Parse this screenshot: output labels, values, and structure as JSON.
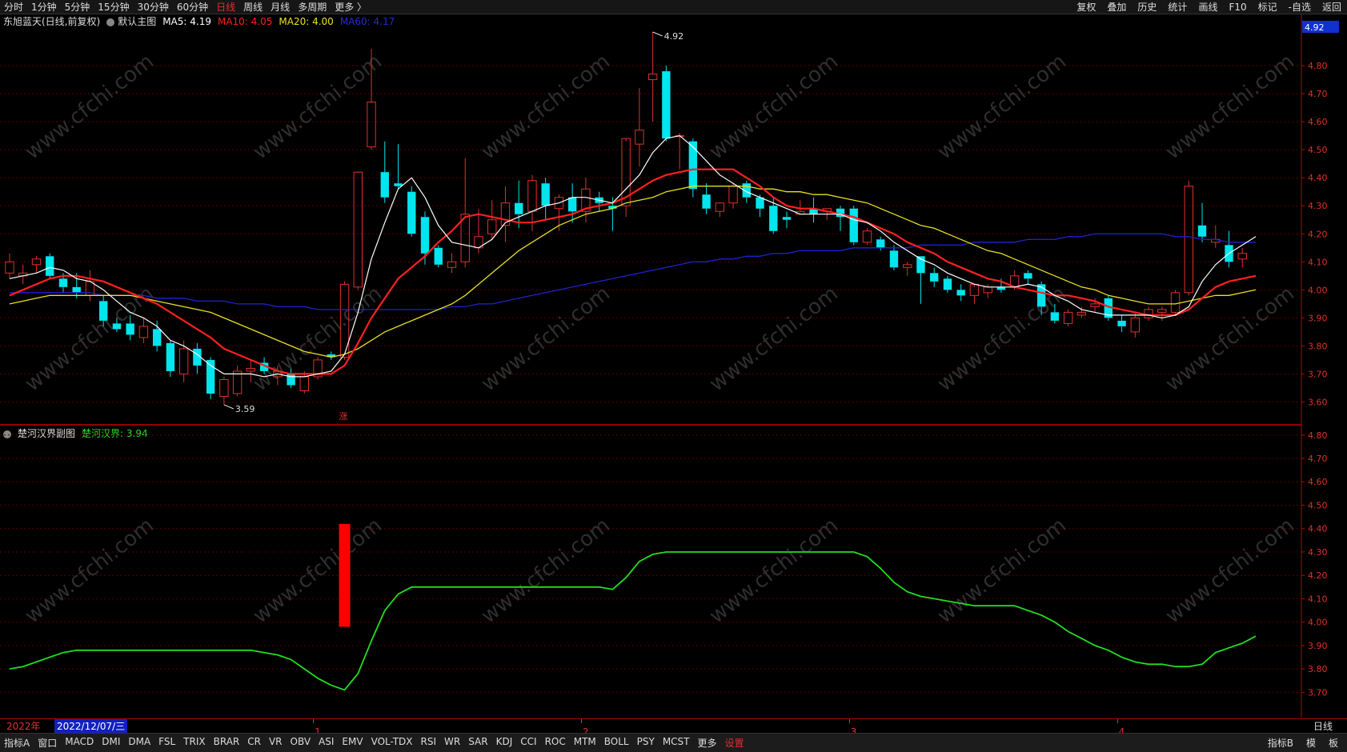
{
  "toolbar": {
    "left": [
      "分时",
      "1分钟",
      "5分钟",
      "15分钟",
      "30分钟",
      "60分钟",
      "日线",
      "周线",
      "月线",
      "多周期",
      "更多 〉"
    ],
    "active": "日线",
    "right": [
      "复权",
      "叠加",
      "历史",
      "统计",
      "画线",
      "F10",
      "标记",
      "-自选",
      "返回"
    ]
  },
  "main_legend": {
    "title": "东旭蓝天(日线,前复权)",
    "chart_name": "默认主图",
    "ma5": "MA5: 4.19",
    "ma10": "MA10: 4.05",
    "ma20": "MA20: 4.00",
    "ma60": "MA60: 4.17"
  },
  "sub_legend": {
    "title": "楚河汉界副图",
    "value": "楚河汉界: 3.94"
  },
  "colors": {
    "up": "#e03030",
    "down": "#00e5ee",
    "ma5": "#ffffff",
    "ma10": "#ff2020",
    "ma20": "#e8e020",
    "ma60": "#2020d0",
    "green": "#22dd22",
    "grid": "#5a0000"
  },
  "current_price_tag": "4.92",
  "rise_marker": "涨",
  "watermark": "www.cfchi.com",
  "timebar": {
    "year": "2022年",
    "cursor_date": "2022/12/07/三",
    "months": [
      "1",
      "2",
      "3",
      "4"
    ],
    "period": "日线"
  },
  "bottom_tabs": [
    "指标A",
    "窗口",
    "MACD",
    "DMI",
    "DMA",
    "FSL",
    "TRIX",
    "BRAR",
    "CR",
    "VR",
    "OBV",
    "ASI",
    "EMV",
    "VOL-TDX",
    "RSI",
    "WR",
    "SAR",
    "KDJ",
    "CCI",
    "ROC",
    "MTM",
    "BOLL",
    "PSY",
    "MCST",
    "更多",
    "设置"
  ],
  "bottom_right": [
    "指标B",
    "模",
    "板"
  ],
  "chart_data": [
    {
      "type": "candlestick",
      "title": "东旭蓝天(日线,前复权)",
      "ylim": [
        3.55,
        4.92
      ],
      "y_ticks": [
        4.8,
        4.7,
        4.6,
        4.5,
        4.4,
        4.3,
        4.2,
        4.1,
        4.0,
        3.9,
        3.8,
        3.7,
        3.6
      ],
      "annotations": [
        {
          "label": "4.92",
          "type": "high"
        },
        {
          "label": "3.59",
          "type": "low"
        }
      ],
      "ohlc": [
        [
          4.06,
          4.13,
          4.04,
          4.1
        ],
        [
          4.05,
          4.09,
          4.02,
          4.06
        ],
        [
          4.09,
          4.12,
          4.06,
          4.11
        ],
        [
          4.12,
          4.13,
          4.04,
          4.05
        ],
        [
          4.04,
          4.06,
          3.99,
          4.01
        ],
        [
          4.01,
          4.06,
          3.97,
          3.99
        ],
        [
          3.98,
          4.07,
          3.96,
          4.03
        ],
        [
          3.96,
          3.98,
          3.87,
          3.89
        ],
        [
          3.88,
          3.9,
          3.85,
          3.86
        ],
        [
          3.88,
          3.91,
          3.82,
          3.84
        ],
        [
          3.83,
          3.9,
          3.81,
          3.87
        ],
        [
          3.86,
          3.89,
          3.78,
          3.8
        ],
        [
          3.81,
          3.82,
          3.69,
          3.71
        ],
        [
          3.7,
          3.82,
          3.67,
          3.79
        ],
        [
          3.79,
          3.81,
          3.7,
          3.73
        ],
        [
          3.75,
          3.76,
          3.61,
          3.63
        ],
        [
          3.62,
          3.69,
          3.59,
          3.68
        ],
        [
          3.63,
          3.73,
          3.62,
          3.71
        ],
        [
          3.71,
          3.75,
          3.67,
          3.72
        ],
        [
          3.74,
          3.76,
          3.7,
          3.71
        ],
        [
          3.69,
          3.73,
          3.66,
          3.71
        ],
        [
          3.7,
          3.72,
          3.65,
          3.66
        ],
        [
          3.64,
          3.71,
          3.63,
          3.69
        ],
        [
          3.69,
          3.76,
          3.68,
          3.75
        ],
        [
          3.77,
          3.78,
          3.75,
          3.76
        ],
        [
          3.76,
          4.03,
          3.75,
          4.02
        ],
        [
          4.01,
          4.42,
          4.0,
          4.42
        ],
        [
          4.51,
          4.86,
          4.5,
          4.67
        ],
        [
          4.42,
          4.53,
          4.31,
          4.33
        ],
        [
          4.38,
          4.52,
          4.36,
          4.37
        ],
        [
          4.35,
          4.37,
          4.19,
          4.2
        ],
        [
          4.26,
          4.28,
          4.09,
          4.13
        ],
        [
          4.15,
          4.16,
          4.08,
          4.09
        ],
        [
          4.08,
          4.13,
          4.06,
          4.1
        ],
        [
          4.1,
          4.47,
          4.08,
          4.27
        ],
        [
          4.15,
          4.29,
          4.13,
          4.19
        ],
        [
          4.2,
          4.32,
          4.18,
          4.25
        ],
        [
          4.23,
          4.37,
          4.17,
          4.31
        ],
        [
          4.31,
          4.39,
          4.22,
          4.27
        ],
        [
          4.28,
          4.41,
          4.21,
          4.39
        ],
        [
          4.38,
          4.4,
          4.25,
          4.3
        ],
        [
          4.29,
          4.34,
          4.21,
          4.33
        ],
        [
          4.33,
          4.38,
          4.24,
          4.28
        ],
        [
          4.28,
          4.4,
          4.24,
          4.36
        ],
        [
          4.33,
          4.35,
          4.28,
          4.31
        ],
        [
          4.3,
          4.33,
          4.21,
          4.29
        ],
        [
          4.3,
          4.53,
          4.26,
          4.54
        ],
        [
          4.52,
          4.72,
          4.44,
          4.57
        ],
        [
          4.75,
          4.92,
          4.6,
          4.77
        ],
        [
          4.78,
          4.8,
          4.53,
          4.54
        ],
        [
          4.55,
          4.56,
          4.43,
          4.55
        ],
        [
          4.53,
          4.54,
          4.33,
          4.36
        ],
        [
          4.34,
          4.38,
          4.27,
          4.29
        ],
        [
          4.28,
          4.31,
          4.26,
          4.31
        ],
        [
          4.31,
          4.38,
          4.29,
          4.37
        ],
        [
          4.38,
          4.39,
          4.31,
          4.33
        ],
        [
          4.33,
          4.34,
          4.26,
          4.29
        ],
        [
          4.3,
          4.33,
          4.2,
          4.21
        ],
        [
          4.26,
          4.28,
          4.22,
          4.25
        ],
        [
          4.27,
          4.32,
          4.27,
          4.28
        ],
        [
          4.29,
          4.33,
          4.24,
          4.27
        ],
        [
          4.28,
          4.29,
          4.25,
          4.29
        ],
        [
          4.29,
          4.3,
          4.21,
          4.26
        ],
        [
          4.29,
          4.3,
          4.16,
          4.17
        ],
        [
          4.17,
          4.22,
          4.16,
          4.21
        ],
        [
          4.18,
          4.19,
          4.14,
          4.15
        ],
        [
          4.14,
          4.16,
          4.07,
          4.08
        ],
        [
          4.08,
          4.1,
          4.05,
          4.09
        ],
        [
          4.12,
          4.12,
          3.95,
          4.06
        ],
        [
          4.06,
          4.08,
          4.01,
          4.03
        ],
        [
          4.04,
          4.05,
          3.99,
          4.0
        ],
        [
          4.0,
          4.02,
          3.96,
          3.98
        ],
        [
          3.98,
          4.01,
          3.95,
          4.02
        ],
        [
          3.99,
          4.02,
          3.97,
          4.01
        ],
        [
          4.01,
          4.04,
          3.99,
          4.0
        ],
        [
          4.01,
          4.07,
          4.0,
          4.05
        ],
        [
          4.06,
          4.07,
          4.02,
          4.04
        ],
        [
          4.02,
          4.03,
          3.91,
          3.94
        ],
        [
          3.92,
          3.95,
          3.88,
          3.89
        ],
        [
          3.88,
          3.93,
          3.87,
          3.92
        ],
        [
          3.91,
          3.94,
          3.9,
          3.92
        ],
        [
          3.94,
          3.97,
          3.92,
          3.95
        ],
        [
          3.97,
          3.98,
          3.89,
          3.9
        ],
        [
          3.89,
          3.91,
          3.85,
          3.87
        ],
        [
          3.85,
          3.92,
          3.83,
          3.9
        ],
        [
          3.9,
          3.94,
          3.89,
          3.93
        ],
        [
          3.92,
          3.94,
          3.89,
          3.93
        ],
        [
          3.92,
          4.0,
          3.91,
          3.99
        ],
        [
          3.99,
          4.39,
          3.98,
          4.37
        ],
        [
          4.23,
          4.31,
          4.17,
          4.19
        ],
        [
          4.17,
          4.23,
          4.15,
          4.18
        ],
        [
          4.16,
          4.21,
          4.08,
          4.1
        ],
        [
          4.11,
          4.15,
          4.08,
          4.13
        ]
      ],
      "ma5": [
        4.04,
        4.05,
        4.06,
        4.08,
        4.07,
        4.04,
        4.03,
        4.0,
        3.96,
        3.92,
        3.9,
        3.87,
        3.82,
        3.8,
        3.77,
        3.73,
        3.7,
        3.7,
        3.7,
        3.69,
        3.7,
        3.69,
        3.69,
        3.7,
        3.71,
        3.77,
        3.92,
        4.11,
        4.24,
        4.36,
        4.4,
        4.33,
        4.23,
        4.17,
        4.16,
        4.15,
        4.18,
        4.24,
        4.26,
        4.28,
        4.3,
        4.31,
        4.33,
        4.33,
        4.32,
        4.31,
        4.36,
        4.41,
        4.49,
        4.54,
        4.55,
        4.51,
        4.46,
        4.41,
        4.38,
        4.35,
        4.33,
        4.31,
        4.29,
        4.27,
        4.27,
        4.27,
        4.27,
        4.25,
        4.24,
        4.21,
        4.17,
        4.14,
        4.11,
        4.09,
        4.06,
        4.04,
        4.02,
        4.01,
        4.01,
        4.01,
        4.02,
        4.01,
        3.98,
        3.96,
        3.93,
        3.92,
        3.91,
        3.91,
        3.91,
        3.91,
        3.9,
        3.91,
        3.94,
        4.03,
        4.09,
        4.13,
        4.16,
        4.19
      ],
      "ma10": [
        3.98,
        4.0,
        4.02,
        4.04,
        4.05,
        4.05,
        4.04,
        4.03,
        4.01,
        3.99,
        3.97,
        3.95,
        3.92,
        3.89,
        3.86,
        3.83,
        3.79,
        3.77,
        3.75,
        3.73,
        3.71,
        3.7,
        3.7,
        3.7,
        3.7,
        3.73,
        3.81,
        3.9,
        3.97,
        4.04,
        4.08,
        4.12,
        4.17,
        4.21,
        4.26,
        4.27,
        4.26,
        4.25,
        4.24,
        4.24,
        4.25,
        4.26,
        4.27,
        4.29,
        4.3,
        4.31,
        4.33,
        4.36,
        4.39,
        4.41,
        4.42,
        4.43,
        4.43,
        4.43,
        4.43,
        4.4,
        4.37,
        4.33,
        4.3,
        4.29,
        4.29,
        4.28,
        4.27,
        4.26,
        4.24,
        4.22,
        4.2,
        4.17,
        4.15,
        4.13,
        4.1,
        4.08,
        4.06,
        4.04,
        4.03,
        4.01,
        4.0,
        3.99,
        3.98,
        3.98,
        3.97,
        3.96,
        3.94,
        3.93,
        3.92,
        3.91,
        3.91,
        3.91,
        3.93,
        3.97,
        4.01,
        4.03,
        4.04,
        4.05
      ],
      "ma20": [
        3.95,
        3.96,
        3.97,
        3.98,
        3.98,
        3.98,
        3.98,
        3.98,
        3.98,
        3.98,
        3.97,
        3.96,
        3.95,
        3.94,
        3.93,
        3.92,
        3.9,
        3.88,
        3.86,
        3.84,
        3.82,
        3.8,
        3.78,
        3.77,
        3.76,
        3.77,
        3.79,
        3.82,
        3.85,
        3.87,
        3.89,
        3.91,
        3.93,
        3.95,
        3.98,
        4.02,
        4.06,
        4.1,
        4.14,
        4.17,
        4.2,
        4.23,
        4.25,
        4.27,
        4.28,
        4.29,
        4.31,
        4.32,
        4.33,
        4.35,
        4.36,
        4.37,
        4.37,
        4.37,
        4.37,
        4.37,
        4.36,
        4.36,
        4.35,
        4.35,
        4.34,
        4.34,
        4.33,
        4.32,
        4.31,
        4.29,
        4.27,
        4.25,
        4.23,
        4.22,
        4.2,
        4.18,
        4.16,
        4.14,
        4.13,
        4.11,
        4.09,
        4.07,
        4.05,
        4.03,
        4.01,
        4.0,
        3.98,
        3.97,
        3.96,
        3.95,
        3.95,
        3.95,
        3.96,
        3.97,
        3.98,
        3.98,
        3.99,
        4.0
      ],
      "ma60": [
        3.99,
        3.99,
        3.99,
        3.99,
        3.99,
        3.99,
        3.99,
        3.98,
        3.98,
        3.98,
        3.98,
        3.97,
        3.97,
        3.97,
        3.96,
        3.96,
        3.96,
        3.95,
        3.95,
        3.95,
        3.94,
        3.94,
        3.94,
        3.93,
        3.93,
        3.93,
        3.93,
        3.93,
        3.93,
        3.93,
        3.93,
        3.93,
        3.93,
        3.94,
        3.94,
        3.95,
        3.95,
        3.96,
        3.97,
        3.98,
        3.99,
        4.0,
        4.01,
        4.02,
        4.03,
        4.04,
        4.05,
        4.06,
        4.07,
        4.08,
        4.09,
        4.1,
        4.1,
        4.11,
        4.11,
        4.12,
        4.12,
        4.13,
        4.13,
        4.14,
        4.14,
        4.14,
        4.14,
        4.15,
        4.15,
        4.15,
        4.15,
        4.15,
        4.16,
        4.16,
        4.16,
        4.16,
        4.17,
        4.17,
        4.17,
        4.17,
        4.18,
        4.18,
        4.18,
        4.19,
        4.19,
        4.2,
        4.2,
        4.2,
        4.2,
        4.2,
        4.2,
        4.19,
        4.19,
        4.18,
        4.18,
        4.17,
        4.17,
        4.17
      ]
    },
    {
      "type": "line",
      "title": "楚河汉界副图",
      "series_name": "楚河汉界",
      "ylim": [
        3.65,
        4.83
      ],
      "y_ticks": [
        4.8,
        4.7,
        4.6,
        4.5,
        4.4,
        4.3,
        4.2,
        4.1,
        4.0,
        3.9,
        3.8,
        3.7
      ],
      "values": [
        3.8,
        3.81,
        3.83,
        3.85,
        3.87,
        3.88,
        3.88,
        3.88,
        3.88,
        3.88,
        3.88,
        3.88,
        3.88,
        3.88,
        3.88,
        3.88,
        3.88,
        3.88,
        3.88,
        3.87,
        3.86,
        3.84,
        3.8,
        3.76,
        3.73,
        3.71,
        3.78,
        3.92,
        4.05,
        4.12,
        4.15,
        4.15,
        4.15,
        4.15,
        4.15,
        4.15,
        4.15,
        4.15,
        4.15,
        4.15,
        4.15,
        4.15,
        4.15,
        4.15,
        4.15,
        4.14,
        4.19,
        4.26,
        4.29,
        4.3,
        4.3,
        4.3,
        4.3,
        4.3,
        4.3,
        4.3,
        4.3,
        4.3,
        4.3,
        4.3,
        4.3,
        4.3,
        4.3,
        4.3,
        4.28,
        4.23,
        4.17,
        4.13,
        4.11,
        4.1,
        4.09,
        4.08,
        4.07,
        4.07,
        4.07,
        4.07,
        4.05,
        4.03,
        4.0,
        3.96,
        3.93,
        3.9,
        3.88,
        3.85,
        3.83,
        3.82,
        3.82,
        3.81,
        3.81,
        3.82,
        3.87,
        3.89,
        3.91,
        3.94
      ],
      "bar_signal": {
        "index": 25,
        "low": 3.98,
        "high": 4.42
      }
    }
  ]
}
